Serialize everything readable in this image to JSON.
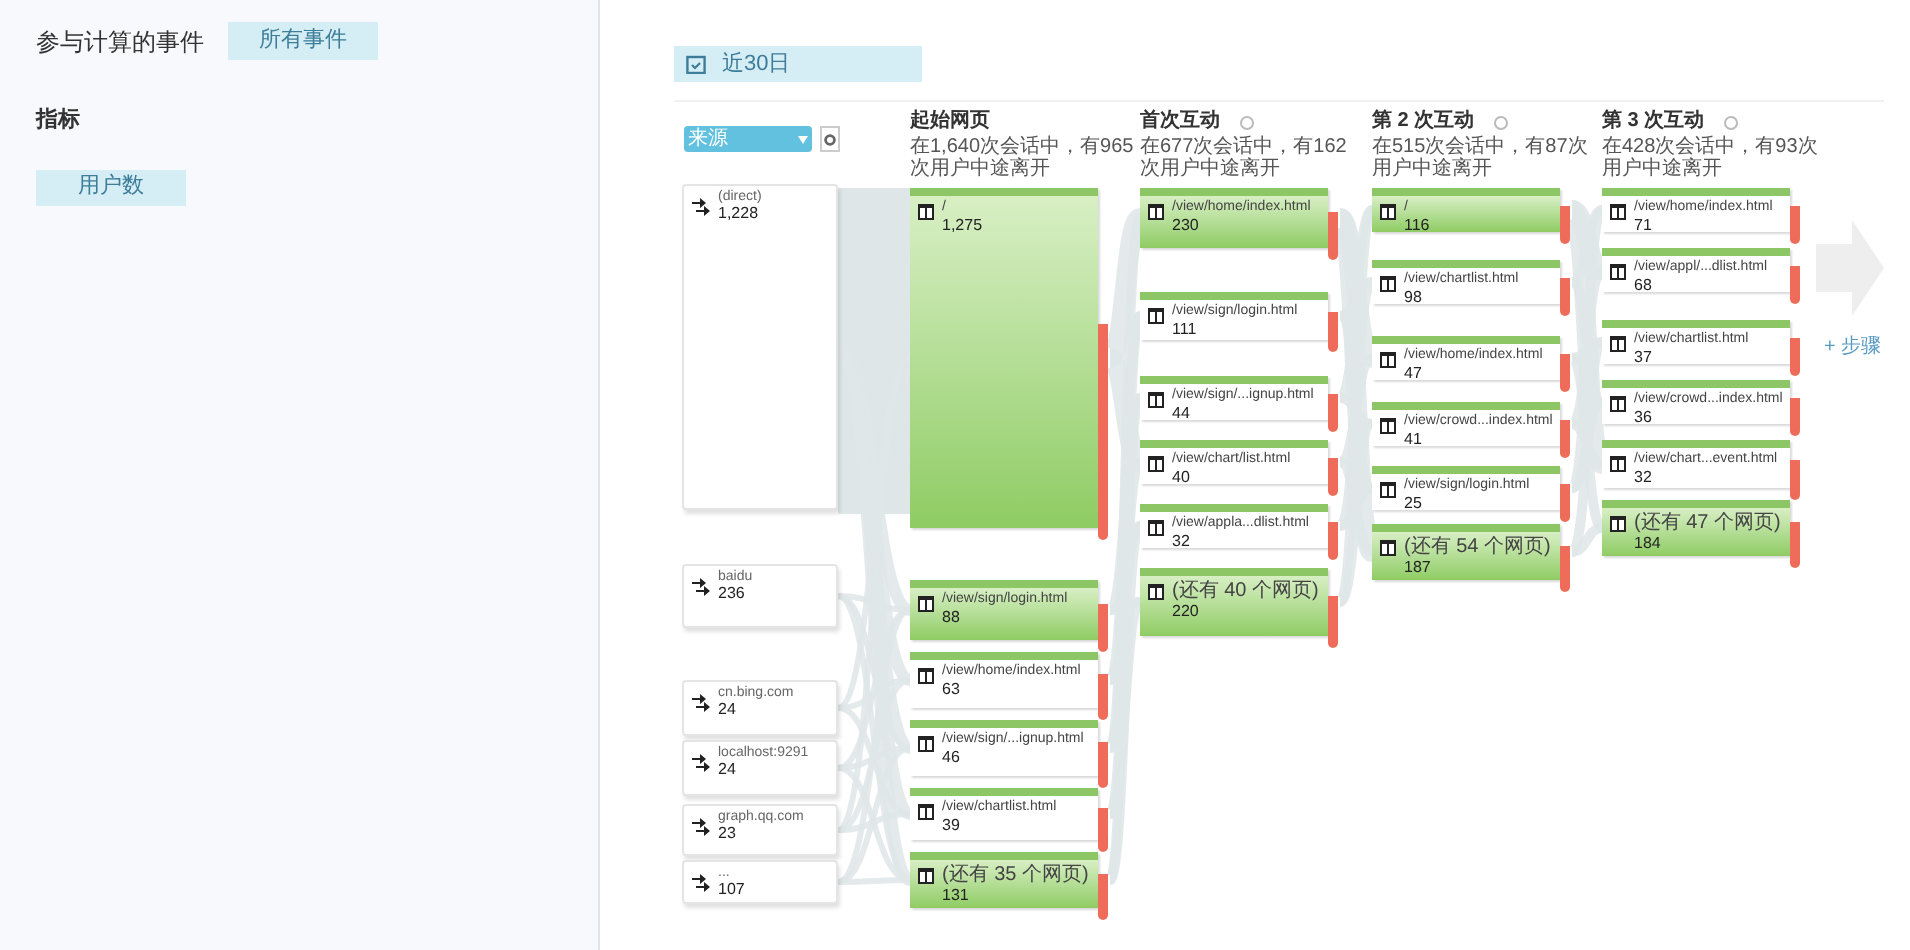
{
  "sidebar": {
    "events_label": "参与计算的事件",
    "events_value": "所有事件",
    "metric_heading": "指标",
    "metric_value": "用户数"
  },
  "date_range": "近30日",
  "dimension_select": "来源",
  "sources": [
    {
      "label": "(direct)",
      "count": "1,228"
    },
    {
      "label": "baidu",
      "count": "236"
    },
    {
      "label": "cn.bing.com",
      "count": "24"
    },
    {
      "label": "localhost:9291",
      "count": "24"
    },
    {
      "label": "graph.qq.com",
      "count": "23"
    },
    {
      "label": "...",
      "count": "107"
    }
  ],
  "columns": [
    {
      "title": "起始网页",
      "info": false,
      "summary": "在1,640次会话中，有965次用户中途离开",
      "nodes": [
        {
          "label": "/",
          "count": "1,275",
          "filled": true
        },
        {
          "label": "/view/sign/login.html",
          "count": "88",
          "filled": true
        },
        {
          "label": "/view/home/index.html",
          "count": "63",
          "filled": false
        },
        {
          "label": "/view/sign/...ignup.html",
          "count": "46",
          "filled": false
        },
        {
          "label": "/view/chartlist.html",
          "count": "39",
          "filled": false
        },
        {
          "label": "(还有 35 个网页)",
          "count": "131",
          "filled": true
        }
      ]
    },
    {
      "title": "首次互动",
      "info": true,
      "summary": "在677次会话中，有162次用户中途离开",
      "nodes": [
        {
          "label": "/view/home/index.html",
          "count": "230",
          "filled": true
        },
        {
          "label": "/view/sign/login.html",
          "count": "111",
          "filled": false
        },
        {
          "label": "/view/sign/...ignup.html",
          "count": "44",
          "filled": false
        },
        {
          "label": "/view/chart/list.html",
          "count": "40",
          "filled": false
        },
        {
          "label": "/view/appla...dlist.html",
          "count": "32",
          "filled": false
        },
        {
          "label": "(还有 40 个网页)",
          "count": "220",
          "filled": true
        }
      ]
    },
    {
      "title": "第 2 次互动",
      "info": true,
      "summary": "在515次会话中，有87次用户中途离开",
      "nodes": [
        {
          "label": "/",
          "count": "116",
          "filled": true
        },
        {
          "label": "/view/chartlist.html",
          "count": "98",
          "filled": false
        },
        {
          "label": "/view/home/index.html",
          "count": "47",
          "filled": false
        },
        {
          "label": "/view/crowd...index.html",
          "count": "41",
          "filled": false
        },
        {
          "label": "/view/sign/login.html",
          "count": "25",
          "filled": false
        },
        {
          "label": "(还有 54 个网页)",
          "count": "187",
          "filled": true
        }
      ]
    },
    {
      "title": "第 3 次互动",
      "info": true,
      "summary": "在428次会话中，有93次用户中途离开",
      "nodes": [
        {
          "label": "/view/home/index.html",
          "count": "71",
          "filled": false
        },
        {
          "label": "/view/appl/...dlist.html",
          "count": "68",
          "filled": false
        },
        {
          "label": "/view/chartlist.html",
          "count": "37",
          "filled": false
        },
        {
          "label": "/view/crowd...index.html",
          "count": "36",
          "filled": false
        },
        {
          "label": "/view/chart...event.html",
          "count": "32",
          "filled": false
        },
        {
          "label": "(还有 47 个网页)",
          "count": "184",
          "filled": true
        }
      ]
    }
  ],
  "add_step": "+ 步骤"
}
